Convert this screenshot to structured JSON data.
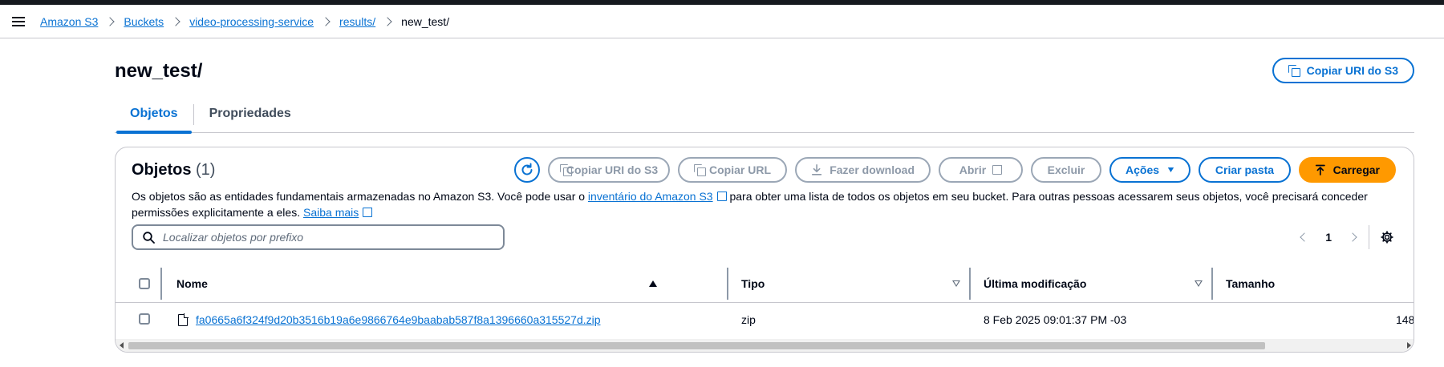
{
  "breadcrumb": {
    "items": [
      "Amazon S3",
      "Buckets",
      "video-processing-service",
      "results/"
    ],
    "current": "new_test/"
  },
  "header": {
    "title": "new_test/",
    "copy_uri_label": "Copiar URI do S3"
  },
  "tabs": [
    {
      "label": "Objetos",
      "active": true
    },
    {
      "label": "Propriedades",
      "active": false
    }
  ],
  "objects_panel": {
    "title": "Objetos",
    "count": "(1)",
    "description_1": "Os objetos são as entidades fundamentais armazenadas no Amazon S3. Você pode usar o ",
    "inventory_link": "inventário do Amazon S3",
    "description_2": " para obter uma lista de todos os objetos em seu bucket. Para outras pessoas acessarem seus objetos, você precisará conceder permissões explicitamente a eles. ",
    "learn_more_link": "Saiba mais",
    "toolbar": {
      "copy_uri": "Copiar URI do S3",
      "copy_url": "Copiar URL",
      "download": "Fazer download",
      "open": "Abrir",
      "delete": "Excluir",
      "actions": "Ações",
      "create_folder": "Criar pasta",
      "upload": "Carregar"
    },
    "search_placeholder": "Localizar objetos por prefixo",
    "pagination": {
      "page": "1"
    },
    "columns": [
      "Nome",
      "Tipo",
      "Última modificação",
      "Tamanho"
    ],
    "rows": [
      {
        "name": "fa0665a6f324f9d20b3516b19a6e9866764e9baabab587f8a1396660a315527d.zip",
        "type": "zip",
        "modified": "8 Feb 2025 09:01:37 PM -03",
        "size": "148"
      }
    ]
  },
  "colors": {
    "link": "#0972d3",
    "primary_button": "#ff9900",
    "disabled": "#8d99a8",
    "text": "#000716"
  },
  "icons": [
    "menu-icon",
    "copy-icon",
    "refresh-icon",
    "download-icon",
    "external-link-icon",
    "caret-down-icon",
    "upload-icon",
    "search-icon",
    "chevron-left-icon",
    "chevron-right-icon",
    "gear-icon",
    "file-icon",
    "sort-ascending-icon",
    "sort-descending-icon"
  ]
}
